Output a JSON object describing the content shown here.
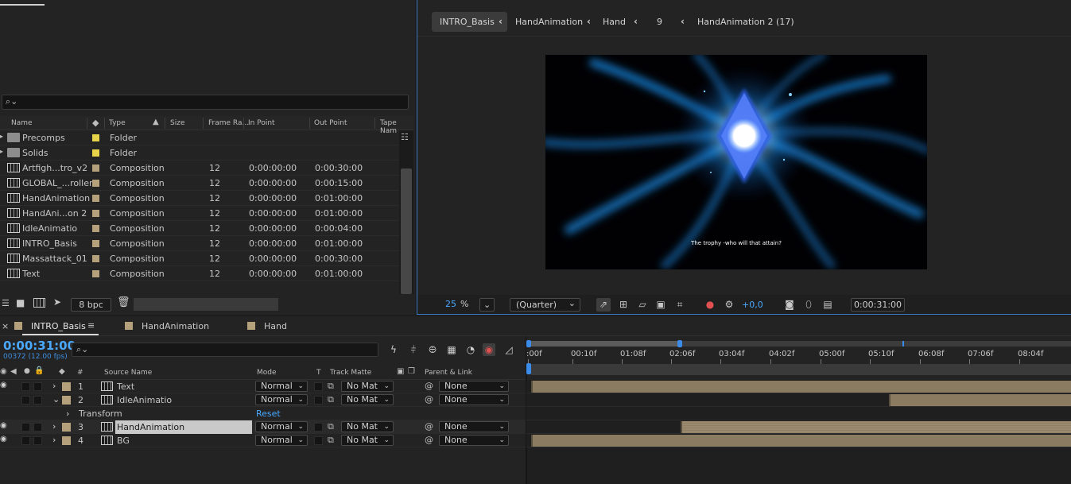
{
  "project": {
    "search_placeholder": "",
    "columns": {
      "name": "Name",
      "type": "Type",
      "size": "Size",
      "frame_rate": "Frame Ra...",
      "in_point": "In Point",
      "out_point": "Out Point",
      "tape_name": "Tape Nam"
    },
    "items": [
      {
        "name": "Precomps",
        "type": "Folder",
        "kind": "folder",
        "label_color": "#e6d34a",
        "frame_rate": "",
        "in": "",
        "out": ""
      },
      {
        "name": "Solids",
        "type": "Folder",
        "kind": "folder",
        "label_color": "#e6d34a",
        "frame_rate": "",
        "in": "",
        "out": ""
      },
      {
        "name": "Artfigh...tro_v2",
        "type": "Composition",
        "kind": "comp",
        "label_color": "#b4a07b",
        "frame_rate": "12",
        "in": "0:00:00:00",
        "out": "0:00:30:00"
      },
      {
        "name": "GLOBAL_...roller",
        "type": "Composition",
        "kind": "comp",
        "label_color": "#b4a07b",
        "frame_rate": "12",
        "in": "0:00:00:00",
        "out": "0:00:15:00"
      },
      {
        "name": "HandAnimation",
        "type": "Composition",
        "kind": "comp",
        "label_color": "#b4a07b",
        "frame_rate": "12",
        "in": "0:00:00:00",
        "out": "0:01:00:00"
      },
      {
        "name": "HandAni...on 2",
        "type": "Composition",
        "kind": "comp",
        "label_color": "#b4a07b",
        "frame_rate": "12",
        "in": "0:00:00:00",
        "out": "0:01:00:00"
      },
      {
        "name": "IdleAnimatio",
        "type": "Composition",
        "kind": "comp",
        "label_color": "#b4a07b",
        "frame_rate": "12",
        "in": "0:00:00:00",
        "out": "0:00:04:00"
      },
      {
        "name": "INTRO_Basis",
        "type": "Composition",
        "kind": "comp",
        "label_color": "#b4a07b",
        "frame_rate": "12",
        "in": "0:00:00:00",
        "out": "0:01:00:00"
      },
      {
        "name": "Massattack_01",
        "type": "Composition",
        "kind": "comp",
        "label_color": "#b4a07b",
        "frame_rate": "12",
        "in": "0:00:00:00",
        "out": "0:00:30:00"
      },
      {
        "name": "Text",
        "type": "Composition",
        "kind": "comp",
        "label_color": "#b4a07b",
        "frame_rate": "12",
        "in": "0:00:00:00",
        "out": "0:01:00:00"
      }
    ],
    "bpc": "8 bpc"
  },
  "viewer": {
    "breadcrumbs": [
      "INTRO_Basis",
      "HandAnimation",
      "Hand",
      "9",
      "HandAnimation 2 (17)"
    ],
    "canvas_caption": "The trophy -who will that attain?",
    "zoom_value": "25",
    "zoom_unit": "%",
    "resolution": "(Quarter)",
    "exposure": "+0,0",
    "current_time": "0:00:31:00"
  },
  "timeline": {
    "tabs": [
      {
        "label": "INTRO_Basis",
        "active": true
      },
      {
        "label": "HandAnimation",
        "active": false
      },
      {
        "label": "Hand",
        "active": false
      }
    ],
    "current_time": "0:00:31:00",
    "frames_info": "00372 (12.00 fps)",
    "columns": {
      "number": "#",
      "source_name": "Source Name",
      "mode": "Mode",
      "t": "T",
      "track_matte": "Track Matte",
      "parent": "Parent & Link"
    },
    "ruler_labels": [
      ":00f",
      "00:10f",
      "01:08f",
      "02:06f",
      "03:04f",
      "04:02f",
      "05:00f",
      "05:10f",
      "06:08f",
      "07:06f",
      "08:04f"
    ],
    "layers": [
      {
        "index": "1",
        "name": "Text",
        "mode": "Normal",
        "matte": "No Mat",
        "parent": "None",
        "expanded": false
      },
      {
        "index": "2",
        "name": "IdleAnimatio",
        "mode": "Normal",
        "matte": "No Mat",
        "parent": "None",
        "expanded": true
      },
      {
        "index": "3",
        "name": "HandAnimation",
        "mode": "Normal",
        "matte": "No Mat",
        "parent": "None",
        "expanded": false
      },
      {
        "index": "4",
        "name": "BG",
        "mode": "Normal",
        "matte": "No Mat",
        "parent": "None",
        "expanded": false
      }
    ],
    "transform_label": "Transform",
    "reset_label": "Reset",
    "colors": {
      "accent": "#4aa8ff",
      "layer_label": "#b4a07b",
      "folder_label": "#e6d34a"
    }
  }
}
